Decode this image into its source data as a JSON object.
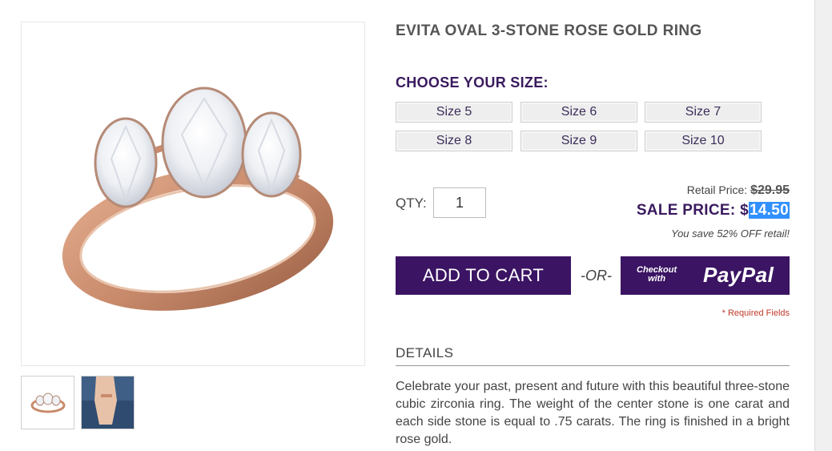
{
  "product": {
    "title": "EVITA OVAL 3-STONE ROSE GOLD RING"
  },
  "size_selector": {
    "heading": "CHOOSE YOUR SIZE:",
    "sizes": [
      "Size 5",
      "Size 6",
      "Size 7",
      "Size 8",
      "Size 9",
      "Size 10"
    ]
  },
  "quantity": {
    "label": "QTY:",
    "value": "1"
  },
  "pricing": {
    "retail_label": "Retail Price:",
    "retail_value": "$29.95",
    "sale_label": "SALE PRICE:",
    "sale_currency": "$",
    "sale_amount": "14.50",
    "savings_text": "You save 52% OFF retail!"
  },
  "actions": {
    "add_to_cart_label": "ADD TO CART",
    "or_text": "-OR-",
    "paypal_small_line1": "Checkout",
    "paypal_small_line2": "with",
    "paypal_brand": "PayPal"
  },
  "required_note": "* Required Fields",
  "details": {
    "heading": "DETAILS",
    "text": "Celebrate your past, present and future with this beautiful three-stone cubic zirconia ring. The weight of the center stone is one carat and each side stone is equal to .75 carats. The ring is finished in a bright rose gold."
  },
  "colors": {
    "brand_purple": "#3b1463",
    "heading_purple": "#3a1a5e",
    "rose_gold": "#c98b6c",
    "highlight_blue": "#3390ff",
    "required_red": "#c0392b"
  }
}
